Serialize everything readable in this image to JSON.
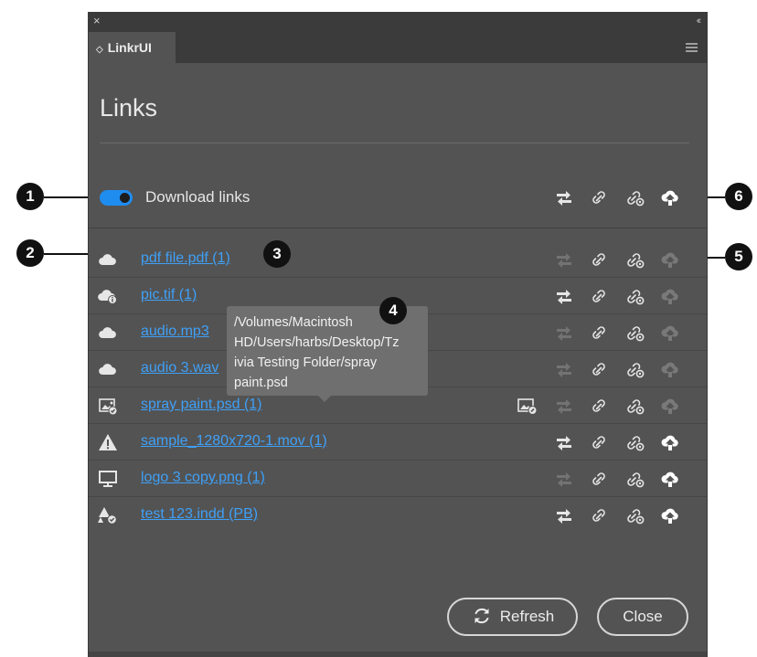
{
  "window": {
    "close_glyph": "×",
    "collapse_glyph": "‹‹"
  },
  "tab": {
    "label": "LinkrUI",
    "chevron": "◇"
  },
  "heading": "Links",
  "download_links": {
    "label": "Download links",
    "enabled": true
  },
  "colors": {
    "accent": "#1f8cf0",
    "link": "#3fa0f7",
    "panel": "#535353"
  },
  "files": [
    {
      "name": "pdf file.pdf (1)",
      "icon": "cloud-icon"
    },
    {
      "name": "pic.tif (1)",
      "icon": "cloud-info-icon"
    },
    {
      "name": "audio.mp3",
      "icon": "cloud-icon"
    },
    {
      "name": "audio 3.wav",
      "icon": "cloud-icon"
    },
    {
      "name": "spray paint.psd (1)",
      "icon": "image-check-icon"
    },
    {
      "name": "sample_1280x720-1.mov (1)",
      "icon": "warning-icon"
    },
    {
      "name": "logo 3 copy.png (1)",
      "icon": "monitor-icon"
    },
    {
      "name": "test 123.indd (PB)",
      "icon": "shapes-check-icon"
    }
  ],
  "tooltip": {
    "lines": [
      "/Volumes/Macintosh",
      "HD/Users/harbs/Desktop/Tz",
      "ivia Testing Folder/spray",
      "paint.psd"
    ]
  },
  "buttons": {
    "refresh": "Refresh",
    "close": "Close"
  },
  "callouts": [
    "1",
    "2",
    "3",
    "4",
    "5",
    "6"
  ]
}
